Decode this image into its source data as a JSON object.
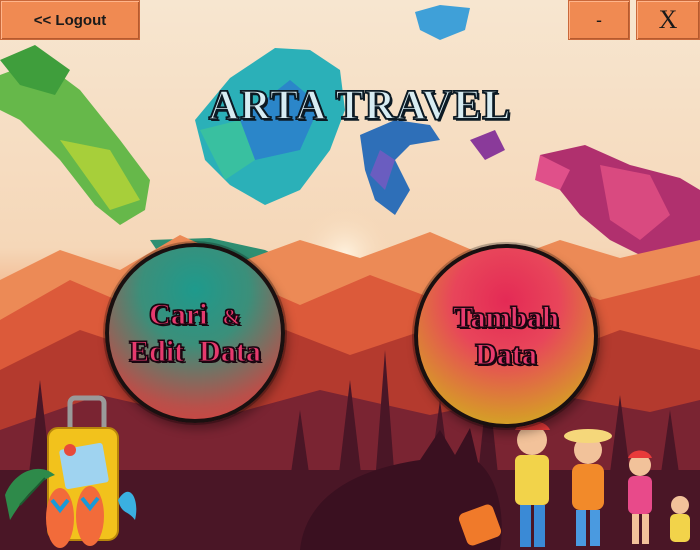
{
  "window": {
    "logout_label": "<< Logout",
    "minimize_label": "-",
    "close_label": "X"
  },
  "header": {
    "title": "ARTA TRAVEL"
  },
  "actions": {
    "search_edit": {
      "line1": "Cari",
      "amp": "&",
      "line2": "Edit  Data"
    },
    "add": {
      "line1": "Tambah",
      "line2": "Data"
    }
  },
  "colors": {
    "top_button": "#f08a52",
    "title_fill": "#d7ecf2",
    "button_text": "#e63a6e",
    "sky": "#f6e0c6",
    "mountains_far": "#e8784a",
    "mountains_mid": "#c8402e",
    "forest": "#5a1e2c"
  },
  "decorations": [
    "indonesia-map-illustration",
    "mountain-landscape",
    "luggage-icon",
    "flip-flops-icon",
    "palm-leaf-icon",
    "traveling-family-illustration",
    "fox-silhouette"
  ]
}
